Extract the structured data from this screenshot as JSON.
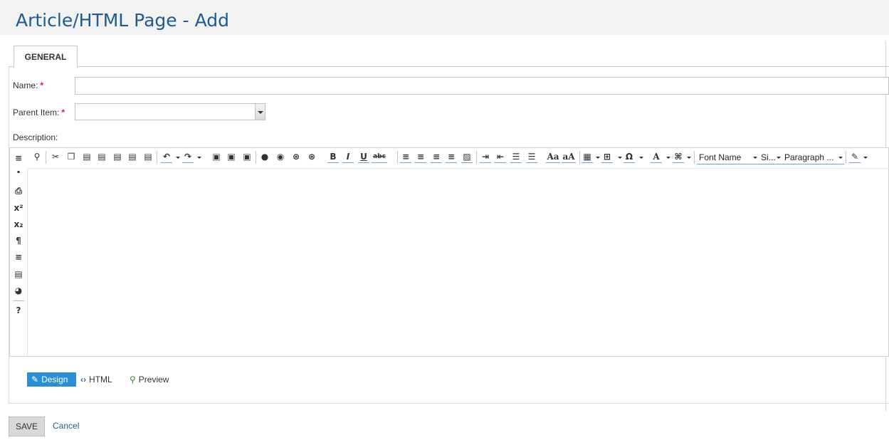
{
  "page": {
    "title": "Article/HTML Page - Add"
  },
  "tabs": [
    {
      "label": "GENERAL"
    }
  ],
  "form": {
    "name_label": "Name:",
    "parent_label": "Parent Item:",
    "description_label": "Description:",
    "required_mark": "*",
    "name_value": "",
    "parent_value": ""
  },
  "toolbar": {
    "bold": "B",
    "italic": "I",
    "underline": "U",
    "strike": "abc",
    "font_case_1": "Aa",
    "font_case_2": "aA",
    "omega": "Ω",
    "font_color": "A",
    "font_name": "Font Name",
    "size": "Si...",
    "paragraph": "Paragraph ...",
    "superscript": "x²",
    "subscript": "x₂",
    "pilcrow": "¶"
  },
  "modes": {
    "design": "Design",
    "html": "HTML",
    "preview": "Preview"
  },
  "actions": {
    "save": "SAVE",
    "cancel": "Cancel"
  },
  "colors": {
    "title": "#1f5a91",
    "accent": "#2a8fd3",
    "required": "#d6202c"
  }
}
